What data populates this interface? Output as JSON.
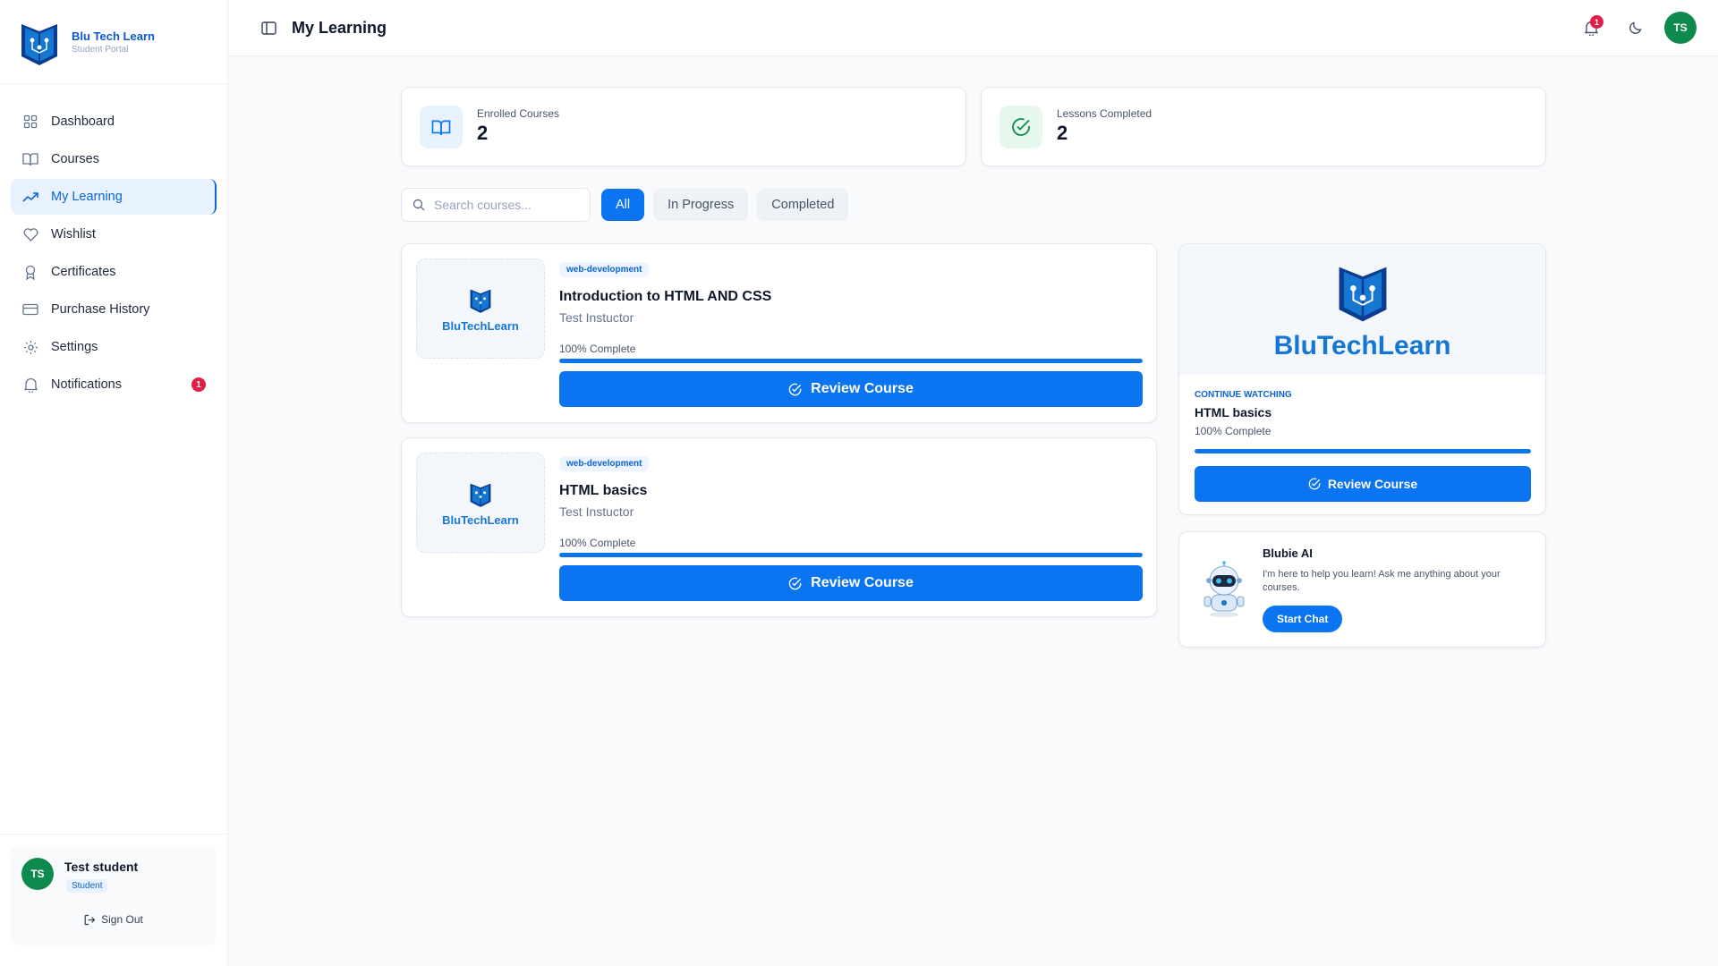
{
  "brand": {
    "name": "Blu Tech Learn",
    "subtitle": "Student Portal"
  },
  "sidebar": {
    "items": [
      {
        "label": "Dashboard",
        "icon": "grid-icon"
      },
      {
        "label": "Courses",
        "icon": "book-open-icon"
      },
      {
        "label": "My Learning",
        "icon": "trending-up-icon",
        "active": true
      },
      {
        "label": "Wishlist",
        "icon": "heart-icon"
      },
      {
        "label": "Certificates",
        "icon": "award-icon"
      },
      {
        "label": "Purchase History",
        "icon": "credit-card-icon"
      },
      {
        "label": "Settings",
        "icon": "gear-icon"
      },
      {
        "label": "Notifications",
        "icon": "bell-icon",
        "badge": "1"
      }
    ]
  },
  "user": {
    "initials": "TS",
    "name": "Test student",
    "role": "Student",
    "sign_out": "Sign Out"
  },
  "header": {
    "title": "My Learning",
    "notification_count": "1",
    "avatar_initials": "TS"
  },
  "stats": [
    {
      "label": "Enrolled Courses",
      "value": "2",
      "icon": "book-open-icon"
    },
    {
      "label": "Lessons Completed",
      "value": "2",
      "icon": "check-circle-icon"
    }
  ],
  "filters": {
    "search_placeholder": "Search courses...",
    "tabs": [
      {
        "label": "All",
        "active": true
      },
      {
        "label": "In Progress",
        "active": false
      },
      {
        "label": "Completed",
        "active": false
      }
    ]
  },
  "courses": [
    {
      "thumb_text": "BluTechLearn",
      "tag": "web-development",
      "title": "Introduction to HTML AND CSS",
      "instructor": "Test Instuctor",
      "progress_text": "100% Complete",
      "progress": 100,
      "button": "Review Course"
    },
    {
      "thumb_text": "BluTechLearn",
      "tag": "web-development",
      "title": "HTML basics",
      "instructor": "Test Instuctor",
      "progress_text": "100% Complete",
      "progress": 100,
      "button": "Review Course"
    }
  ],
  "continue_watching": {
    "banner_text": "BluTechLearn",
    "label": "CONTINUE WATCHING",
    "title": "HTML basics",
    "progress_text": "100% Complete",
    "progress": 100,
    "button": "Review Course"
  },
  "ai": {
    "title": "Blubie AI",
    "description": "I'm here to help you learn! Ask me anything about your courses.",
    "button": "Start Chat"
  },
  "colors": {
    "primary": "#0b74f0",
    "brand": "#0b57d0",
    "success": "#0f8a4f",
    "danger": "#e11d48"
  }
}
